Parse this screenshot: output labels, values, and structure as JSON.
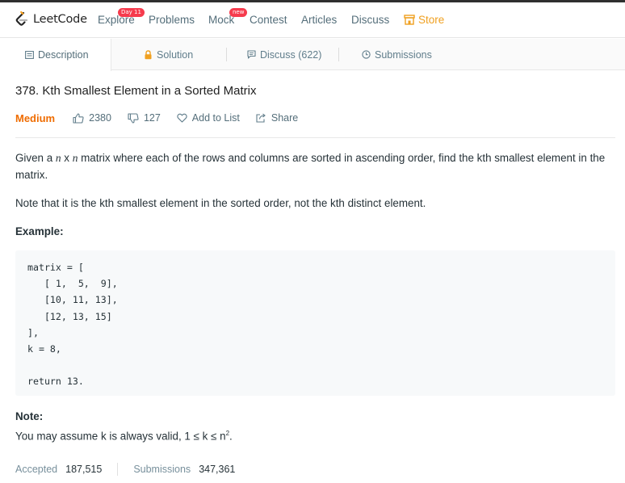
{
  "nav": {
    "brand": "LeetCode",
    "items": [
      {
        "label": "Explore",
        "badge": "Day 11"
      },
      {
        "label": "Problems"
      },
      {
        "label": "Mock",
        "badge": "new"
      },
      {
        "label": "Contest"
      },
      {
        "label": "Articles"
      },
      {
        "label": "Discuss"
      },
      {
        "label": "Store",
        "icon": "store-icon"
      }
    ],
    "colors": {
      "badge": "#f63b4d",
      "store": "#f0a020"
    }
  },
  "tabs": [
    {
      "label": "Description",
      "icon": "description-icon",
      "active": true
    },
    {
      "label": "Solution",
      "icon": "lock-icon"
    },
    {
      "label": "Discuss (622)",
      "icon": "discuss-icon"
    },
    {
      "label": "Submissions",
      "icon": "clock-icon"
    }
  ],
  "problem": {
    "title": "378. Kth Smallest Element in a Sorted Matrix",
    "difficulty": "Medium",
    "difficulty_color": "#ef6c00",
    "likes": "2380",
    "dislikes": "127",
    "add_to_list": "Add to List",
    "share": "Share",
    "desc_before": "Given a ",
    "desc_n1": "n",
    "desc_x": " x ",
    "desc_n2": "n",
    "desc_after": " matrix where each of the rows and columns are sorted in ascending order, find the kth smallest element in the matrix.",
    "note_line": "Note that it is the kth smallest element in the sorted order, not the kth distinct element.",
    "example_heading": "Example:",
    "example_code": "matrix = [\n   [ 1,  5,  9],\n   [10, 11, 13],\n   [12, 13, 15]\n],\nk = 8,\n\nreturn 13.",
    "note_heading": "Note:",
    "note_text_before": "You may assume k is always valid, 1 ≤ k ≤ n",
    "note_sup": "2",
    "note_text_after": "."
  },
  "stats": {
    "accepted_label": "Accepted",
    "accepted_value": "187,515",
    "submissions_label": "Submissions",
    "submissions_value": "347,361"
  }
}
